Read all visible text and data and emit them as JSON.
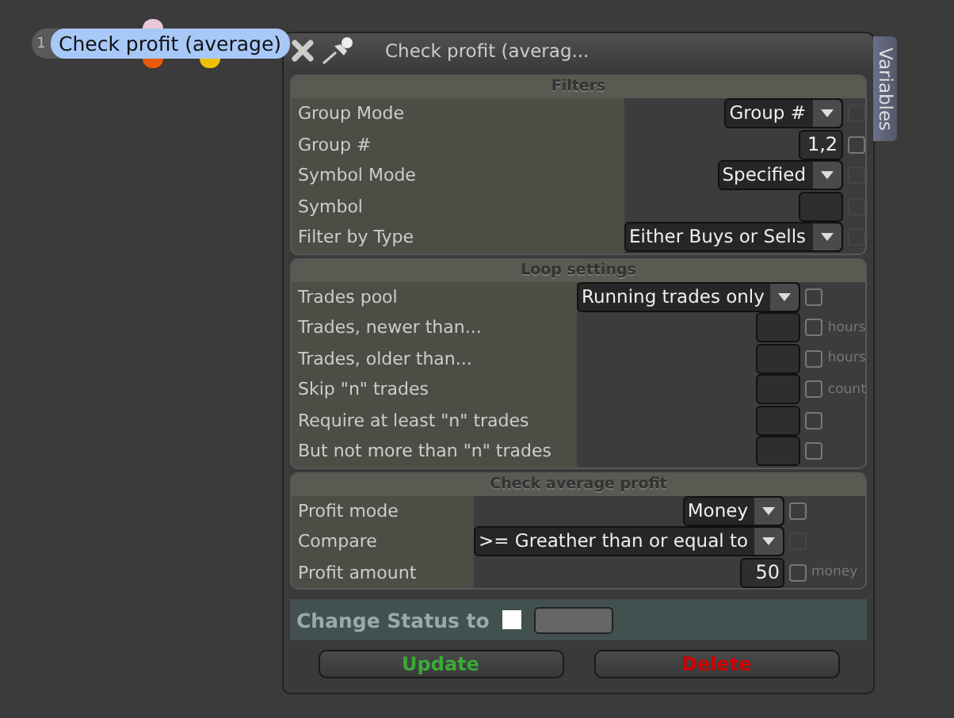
{
  "node": {
    "number": "1",
    "label": "Check profit (average)",
    "ports": [
      {
        "color": "#e8c8d8"
      },
      {
        "color": "#e85a0a"
      },
      {
        "color": "#f0c000"
      }
    ]
  },
  "window": {
    "title": "Check profit (averag...",
    "side_tab": "Variables"
  },
  "sections": [
    {
      "title": "Filters",
      "rows": [
        {
          "label": "Group Mode",
          "kind": "dropdown",
          "value": "Group #",
          "checkbox_disabled": true,
          "checked": false
        },
        {
          "label": "Group #",
          "kind": "input",
          "value": "1,2",
          "checkbox_disabled": false,
          "checked": false
        },
        {
          "label": "Symbol Mode",
          "kind": "dropdown",
          "value": "Specified",
          "checkbox_disabled": true,
          "checked": false
        },
        {
          "label": "Symbol",
          "kind": "input",
          "checkbox_disabled": true,
          "checked": false
        },
        {
          "label": "Filter by Type",
          "kind": "dropdown",
          "value": "Either Buys or Sells",
          "checkbox_disabled": true,
          "checked": false
        }
      ]
    },
    {
      "title": "Loop settings",
      "rows": [
        {
          "label": "Trades pool",
          "kind": "dropdown",
          "value": "Running trades only",
          "checkbox_disabled": false,
          "checked": false
        },
        {
          "label": "Trades, newer than...",
          "kind": "input",
          "unit": "hours",
          "checkbox_disabled": false,
          "checked": false
        },
        {
          "label": "Trades, older than...",
          "kind": "input",
          "unit": "hours",
          "checkbox_disabled": false,
          "checked": false
        },
        {
          "label": "Skip \"n\" trades",
          "kind": "input",
          "unit": "count",
          "checkbox_disabled": false,
          "checked": false
        },
        {
          "label": "Require at least \"n\" trades",
          "kind": "input",
          "checkbox_disabled": false,
          "checked": false
        },
        {
          "label": "But not more than \"n\" trades",
          "kind": "input",
          "checkbox_disabled": false,
          "checked": false
        }
      ]
    },
    {
      "title": "Check average profit",
      "rows": [
        {
          "label": "Profit mode",
          "kind": "dropdown",
          "value": "Money",
          "checkbox_disabled": false,
          "checked": false
        },
        {
          "label": "Compare",
          "kind": "dropdown",
          "value": ">= Greather than or equal to",
          "checkbox_disabled": true,
          "checked": false
        },
        {
          "label": "Profit amount",
          "kind": "input",
          "value": "50",
          "unit": "money",
          "checkbox_disabled": false,
          "checked": false
        }
      ]
    }
  ],
  "status": {
    "label": "Change Status to",
    "checked": false
  },
  "buttons": [
    {
      "label": "Update",
      "kind": "update"
    },
    {
      "label": "Delete",
      "kind": "delete"
    }
  ]
}
